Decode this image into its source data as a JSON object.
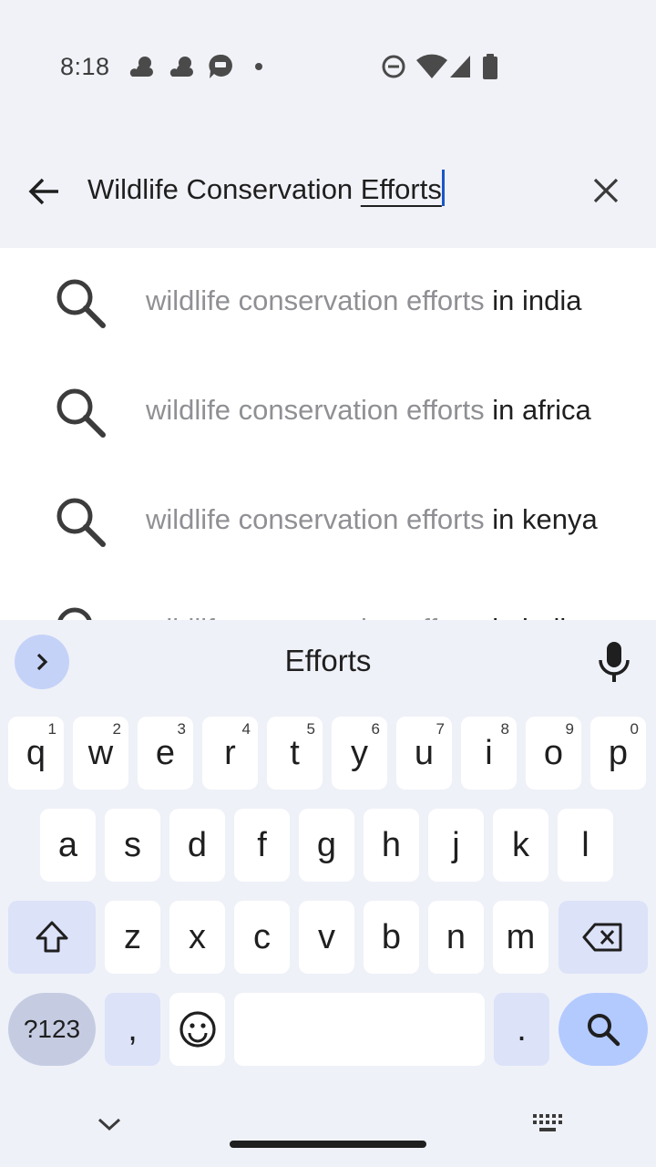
{
  "status_bar": {
    "time": "8:18",
    "icons": [
      "cloud-sun-icon",
      "cloud-sun-icon",
      "message-bubble-icon",
      "dot-icon",
      "do-not-disturb-icon",
      "wifi-icon",
      "signal-icon",
      "battery-icon"
    ]
  },
  "search": {
    "query_plain": "Wildlife Conservation ",
    "query_composing": "Efforts",
    "back_icon": "arrow-back-icon",
    "clear_icon": "close-icon"
  },
  "suggestions": [
    {
      "matched": "wildlife conservation efforts",
      "rest": " in india"
    },
    {
      "matched": "wildlife conservation efforts",
      "rest": " in africa"
    },
    {
      "matched": "wildlife conservation efforts",
      "rest": " in kenya"
    },
    {
      "matched": "wildlife conservation efforts",
      "rest": " in india"
    }
  ],
  "keyboard": {
    "suggestion_word": "Efforts",
    "row1": [
      {
        "k": "q",
        "h": "1"
      },
      {
        "k": "w",
        "h": "2"
      },
      {
        "k": "e",
        "h": "3"
      },
      {
        "k": "r",
        "h": "4"
      },
      {
        "k": "t",
        "h": "5"
      },
      {
        "k": "y",
        "h": "6"
      },
      {
        "k": "u",
        "h": "7"
      },
      {
        "k": "i",
        "h": "8"
      },
      {
        "k": "o",
        "h": "9"
      },
      {
        "k": "p",
        "h": "0"
      }
    ],
    "row2": [
      "a",
      "s",
      "d",
      "f",
      "g",
      "h",
      "j",
      "k",
      "l"
    ],
    "row3": [
      "z",
      "x",
      "c",
      "v",
      "b",
      "n",
      "m"
    ],
    "symbols_label": "?123",
    "comma_label": ",",
    "period_label": ".",
    "colors": {
      "background": "#eff1f8",
      "key": "#ffffff",
      "modifier": "#dce2f8",
      "action": "#b3caff"
    }
  }
}
